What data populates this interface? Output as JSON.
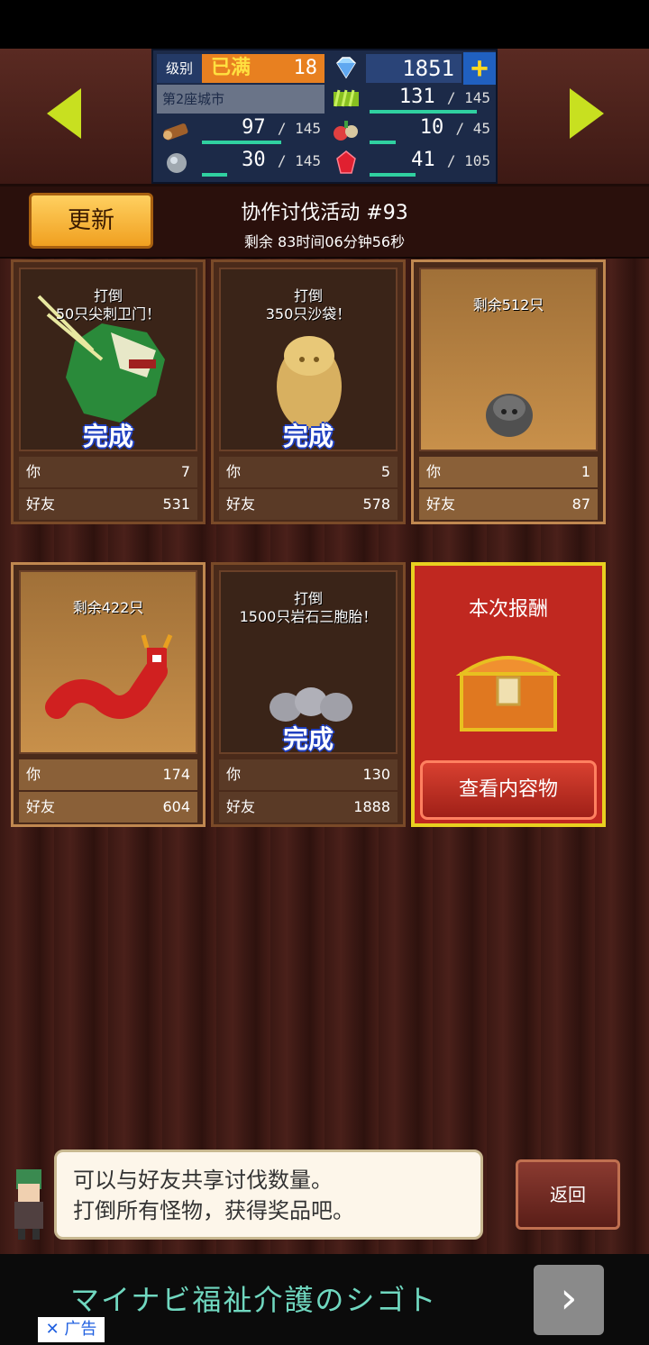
{
  "hud": {
    "level_label": "级别",
    "level_badge": "已满",
    "level_value": "18",
    "gems": "1851",
    "city": "第2座城市",
    "wood": {
      "value": "97",
      "max": "145",
      "fill": 0.67
    },
    "grass": {
      "value": "131",
      "max": "145",
      "fill": 0.9
    },
    "stone": {
      "value": "30",
      "max": "145",
      "fill": 0.21
    },
    "food": {
      "value": "10",
      "max": "45",
      "fill": 0.22
    },
    "ruby": {
      "value": "41",
      "max": "105",
      "fill": 0.39
    }
  },
  "event": {
    "refresh_label": "更新",
    "title": "协作讨伐活动 #93",
    "time_left": "剩余 83时间06分钟56秒"
  },
  "cards": [
    {
      "text": "打倒\n50只尖刺卫门！",
      "done": "完成",
      "you_label": "你",
      "you": "7",
      "friends_label": "好友",
      "friends": "531"
    },
    {
      "text": "打倒\n350只沙袋！",
      "done": "完成",
      "you_label": "你",
      "you": "5",
      "friends_label": "好友",
      "friends": "578"
    },
    {
      "text": "剩余512只",
      "done": "",
      "you_label": "你",
      "you": "1",
      "friends_label": "好友",
      "friends": "87"
    },
    {
      "text": "剩余422只",
      "done": "",
      "you_label": "你",
      "you": "174",
      "friends_label": "好友",
      "friends": "604"
    },
    {
      "text": "打倒\n1500只岩石三胞胎！",
      "done": "完成",
      "you_label": "你",
      "you": "130",
      "friends_label": "好友",
      "friends": "1888"
    }
  ],
  "reward": {
    "title": "本次报酬",
    "button": "查看内容物"
  },
  "dialog": {
    "line1": "可以与好友共享讨伐数量。",
    "line2": "打倒所有怪物，获得奖品吧。"
  },
  "back_label": "返回",
  "ad": {
    "text": "マイナビ福祉介護のシゴト",
    "tag": "✕ 广告",
    "arrow": "›"
  }
}
